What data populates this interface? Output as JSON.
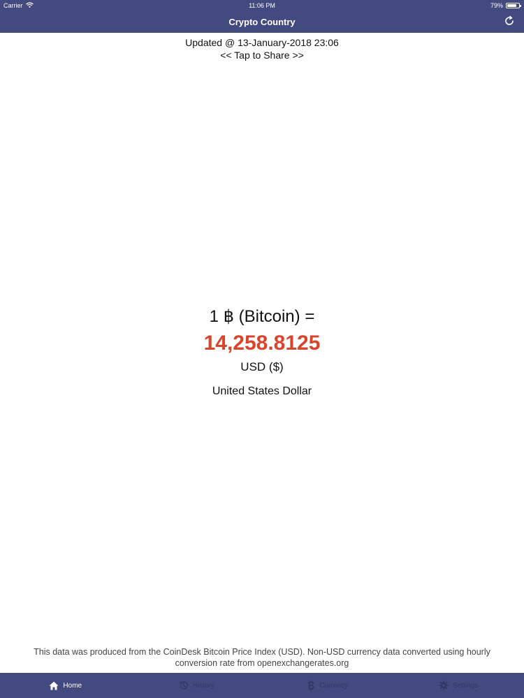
{
  "status_bar": {
    "carrier": "Carrier",
    "time": "11:06 PM",
    "battery": "79%",
    "battery_level": 0.79
  },
  "nav": {
    "title": "Crypto Country",
    "refresh_icon": "refresh-icon"
  },
  "update": {
    "updated_text": "Updated @ 13-January-2018 23:06",
    "share_text": "<< Tap to Share >>"
  },
  "price": {
    "btc_line": "1 ฿ (Bitcoin) =",
    "value": "14,258.8125",
    "currency_code": "USD ($)",
    "currency_name": "United States Dollar"
  },
  "attribution": {
    "text": "This data was produced from the CoinDesk Bitcoin Price Index (USD). Non-USD currency data converted using hourly conversion rate from openexchangerates.org"
  },
  "tabs": [
    {
      "label": "Home",
      "icon": "home-icon",
      "active": true
    },
    {
      "label": "History",
      "icon": "history-icon",
      "active": false
    },
    {
      "label": "Currency",
      "icon": "bitcoin-icon",
      "active": false
    },
    {
      "label": "Settings",
      "icon": "gear-icon",
      "active": false
    }
  ],
  "colors": {
    "header": "#424a80",
    "price": "#d9442c",
    "tab_active": "#ffffff",
    "tab_inactive": "#323866"
  }
}
